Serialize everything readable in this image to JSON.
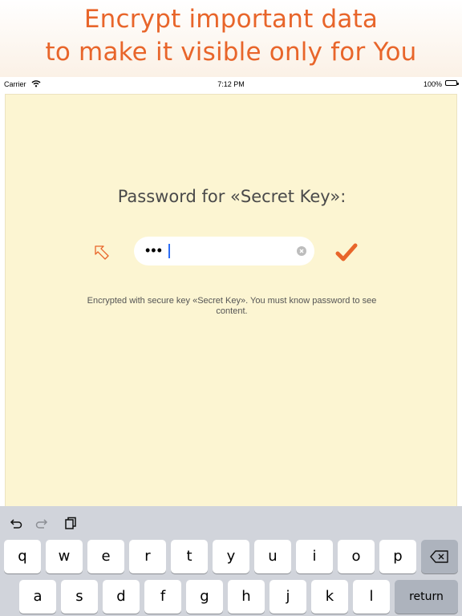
{
  "banner": {
    "line1": "Encrypt important data",
    "line2": "to make it visible only for You"
  },
  "status_bar": {
    "carrier": "Carrier",
    "time": "7:12 PM",
    "battery": "100%"
  },
  "password_dialog": {
    "title": "Password for «Secret Key»:",
    "password_value": "•••",
    "info": "Encrypted with secure key «Secret Key». You must know password to see content."
  },
  "keyboard": {
    "row1": [
      "q",
      "w",
      "e",
      "r",
      "t",
      "y",
      "u",
      "i",
      "o",
      "p"
    ],
    "row2": [
      "a",
      "s",
      "d",
      "f",
      "g",
      "h",
      "j",
      "k",
      "l"
    ],
    "return_label": "return"
  },
  "colors": {
    "accent": "#e8652a",
    "content_background": "#fcf5d2",
    "keyboard_background": "#d1d4db"
  },
  "icons": [
    "wifi-icon",
    "battery-icon",
    "hint-arrow-icon",
    "clear-icon",
    "checkmark-icon",
    "undo-icon",
    "redo-icon",
    "clipboard-icon",
    "backspace-icon"
  ]
}
